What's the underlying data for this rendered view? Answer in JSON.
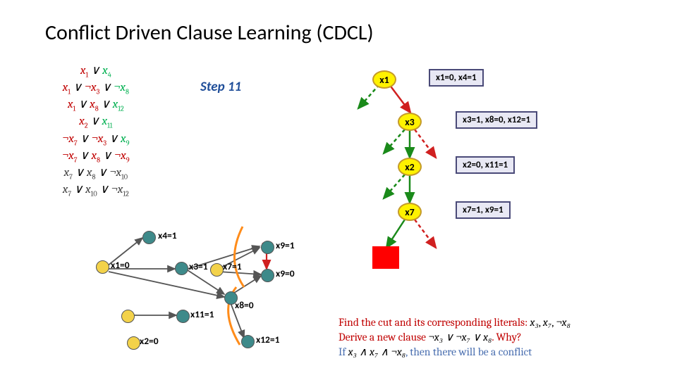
{
  "title": "Conflict Driven Clause Learning (CDCL)",
  "step_label": "Step 11",
  "clauses": [
    [
      {
        "t": "x",
        "s": "1",
        "c": "r"
      },
      {
        "t": " ∨ ",
        "c": "b"
      },
      {
        "t": "x",
        "s": "4",
        "c": "g"
      }
    ],
    [
      {
        "t": "x",
        "s": "1",
        "c": "r"
      },
      {
        "t": " ∨ ",
        "c": "b"
      },
      {
        "t": "¬x",
        "s": "3",
        "c": "r"
      },
      {
        "t": " ∨ ",
        "c": "b"
      },
      {
        "t": "¬x",
        "s": "8",
        "c": "g"
      }
    ],
    [
      {
        "t": "x",
        "s": "1",
        "c": "r"
      },
      {
        "t": " ∨ ",
        "c": "b"
      },
      {
        "t": "x",
        "s": "8",
        "c": "r"
      },
      {
        "t": " ∨ ",
        "c": "b"
      },
      {
        "t": "x",
        "s": "12",
        "c": "g"
      }
    ],
    [
      {
        "t": "x",
        "s": "2",
        "c": "r"
      },
      {
        "t": " ∨ ",
        "c": "b"
      },
      {
        "t": "x",
        "s": "11",
        "c": "g"
      }
    ],
    [
      {
        "t": "¬x",
        "s": "7",
        "c": "r"
      },
      {
        "t": " ∨ ",
        "c": "b"
      },
      {
        "t": "¬x",
        "s": "3",
        "c": "r"
      },
      {
        "t": " ∨ ",
        "c": "b"
      },
      {
        "t": "x",
        "s": "9",
        "c": "g"
      }
    ],
    [
      {
        "t": "¬x",
        "s": "7",
        "c": "r"
      },
      {
        "t": " ∨ ",
        "c": "b"
      },
      {
        "t": "x",
        "s": "8",
        "c": "r"
      },
      {
        "t": " ∨ ",
        "c": "b"
      },
      {
        "t": "¬x",
        "s": "9",
        "c": "r"
      }
    ],
    [
      {
        "t": "x",
        "s": "7",
        "c": "d"
      },
      {
        "t": " ∨ ",
        "c": "b"
      },
      {
        "t": "x",
        "s": "8",
        "c": "d"
      },
      {
        "t": " ∨ ",
        "c": "b"
      },
      {
        "t": "¬x",
        "s": "10",
        "c": "d"
      }
    ],
    [
      {
        "t": "x",
        "s": "7",
        "c": "d"
      },
      {
        "t": " ∨ ",
        "c": "b"
      },
      {
        "t": "x",
        "s": "10",
        "c": "d"
      },
      {
        "t": " ∨ ",
        "c": "b"
      },
      {
        "t": "¬x",
        "s": "12",
        "c": "d"
      }
    ]
  ],
  "tree": {
    "nodes": [
      "x1",
      "x3",
      "x2",
      "x7"
    ],
    "boxes": [
      "x1=0, x4=1",
      "x3=1, x8=0, x12=1",
      "x2=0, x11=1",
      "x7=1, x9=1"
    ]
  },
  "implication": {
    "labels": {
      "x4": "x4=1",
      "x1": "x1=0",
      "x3": "x3=1",
      "x7": "x7=1",
      "x8": "x8=0",
      "x9a": "x9=1",
      "x9b": "x9=0",
      "x11": "x11=1",
      "x2": "x2=0",
      "x12": "x12=1"
    }
  },
  "explain": {
    "line1_a": "Find the cut and its corresponding literals: ",
    "line1_b_parts": [
      "x₃",
      ", ",
      "x₇",
      ", ",
      "¬x₈"
    ],
    "line2_a": "Derive a new clause ",
    "line2_b": "¬x₃ ∨ ¬x₇ ∨ x₈",
    "line2_c": ". Why?",
    "line3_a": "If ",
    "line3_b": "x₃ ∧ x₇ ∧ ¬x₈",
    "line3_c": ", then there will be a conflict"
  }
}
